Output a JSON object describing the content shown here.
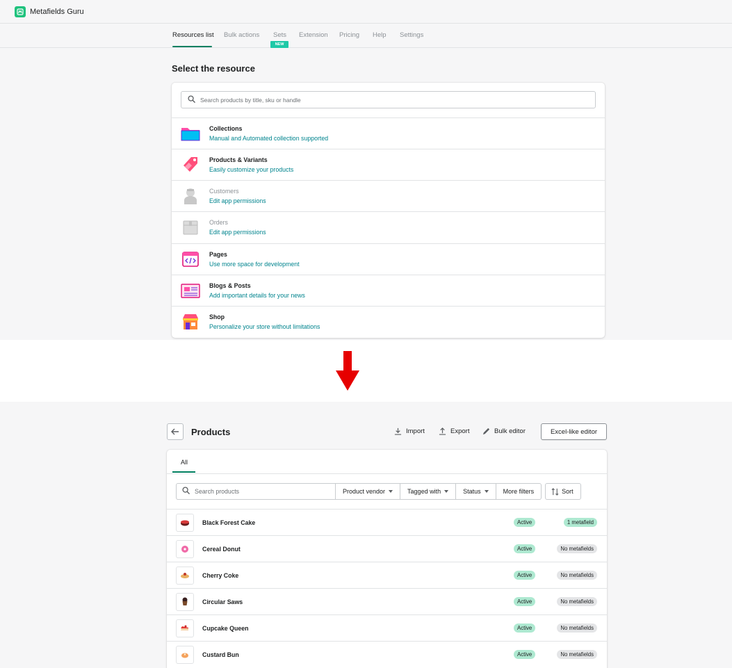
{
  "app": {
    "title": "Metafields Guru",
    "accent": "#1fc27d"
  },
  "nav": {
    "tabs": [
      "Resources list",
      "Bulk actions",
      "Sets",
      "Extension",
      "Pricing",
      "Help",
      "Settings"
    ],
    "active": "Resources list",
    "new_badge": "NEW"
  },
  "resources": {
    "title": "Select the resource",
    "search_placeholder": "Search products by title, sku or handle",
    "items": [
      {
        "title": "Collections",
        "subtitle": "Manual and Automated collection supported",
        "icon": "folder-icon",
        "enabled": true
      },
      {
        "title": "Products & Variants",
        "subtitle": "Easily customize your products",
        "icon": "price-tag-icon",
        "enabled": true
      },
      {
        "title": "Customers",
        "subtitle": "Edit app permissions",
        "icon": "customer-icon",
        "enabled": false
      },
      {
        "title": "Orders",
        "subtitle": "Edit app permissions",
        "icon": "box-icon",
        "enabled": false
      },
      {
        "title": "Pages",
        "subtitle": "Use more space for development",
        "icon": "code-page-icon",
        "enabled": true
      },
      {
        "title": "Blogs & Posts",
        "subtitle": "Add important details for your news",
        "icon": "newspaper-icon",
        "enabled": true
      },
      {
        "title": "Shop",
        "subtitle": "Personalize your store without limitations",
        "icon": "storefront-icon",
        "enabled": true
      }
    ]
  },
  "products_page": {
    "title": "Products",
    "actions": {
      "import": "Import",
      "export": "Export",
      "bulk_editor": "Bulk editor",
      "excel_editor": "Excel-like editor"
    },
    "tab_all": "All",
    "search_placeholder": "Search products",
    "filters": {
      "vendor": "Product vendor",
      "tagged": "Tagged with",
      "status": "Status",
      "more": "More filters",
      "sort": "Sort"
    },
    "rows": [
      {
        "name": "Black Forest Cake",
        "status": "Active",
        "metafields": "1 metafield",
        "has_meta": true,
        "thumb": "cake-icon"
      },
      {
        "name": "Cereal Donut",
        "status": "Active",
        "metafields": "No metafields",
        "has_meta": false,
        "thumb": "donut-icon"
      },
      {
        "name": "Cherry Coke",
        "status": "Active",
        "metafields": "No metafields",
        "has_meta": false,
        "thumb": "dessert-icon"
      },
      {
        "name": "Circular Saws",
        "status": "Active",
        "metafields": "No metafields",
        "has_meta": false,
        "thumb": "cupcake-icon"
      },
      {
        "name": "Cupcake Queen",
        "status": "Active",
        "metafields": "No metafields",
        "has_meta": false,
        "thumb": "cake-slice-icon"
      },
      {
        "name": "Custard Bun",
        "status": "Active",
        "metafields": "No metafields",
        "has_meta": false,
        "thumb": "bun-icon"
      }
    ]
  },
  "colors": {
    "link": "#00848e",
    "primary_green": "#008060",
    "status_bg": "#aee9d1",
    "neutral_bg": "#e4e5e7",
    "arrow": "#e60000",
    "badge": "#1fc9a7"
  }
}
